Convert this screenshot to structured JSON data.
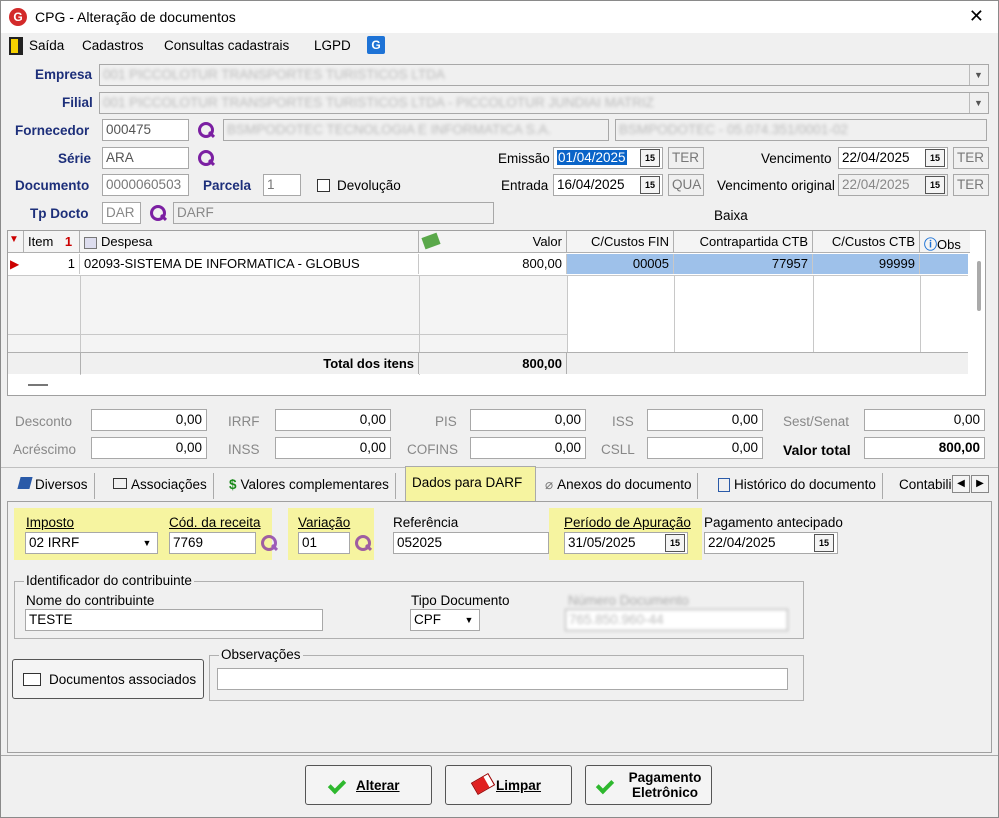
{
  "window": {
    "title": "CPG - Alteração de documentos",
    "close": "✕"
  },
  "menu": {
    "items": [
      "Saída",
      "Cadastros",
      "Consultas cadastrais",
      "LGPD"
    ]
  },
  "header": {
    "empresa_label": "Empresa",
    "empresa_value": "001 PICCOLOTUR TRANSPORTES TURISTICOS LTDA",
    "filial_label": "Filial",
    "filial_value": "001 PICCOLOTUR TRANSPORTES TURISTICOS LTDA - PICCOLOTUR JUNDIAI MATRIZ",
    "fornecedor_label": "Fornecedor",
    "fornecedor_code": "000475",
    "fornecedor_name": "BSMPODOTEC TECNOLOGIA E INFORMATICA S.A.",
    "fornecedor_extra": "BSMPODOTEC - 05.074.351/0001-02",
    "serie_label": "Série",
    "serie_value": "ARA",
    "documento_label": "Documento",
    "documento_value": "0000060503",
    "parcela_label": "Parcela",
    "parcela_value": "1",
    "devolucao_label": "Devolução",
    "tpdocto_label": "Tp Docto",
    "tpdocto_code": "DAR",
    "tpdocto_name": "DARF",
    "emissao_label": "Emissão",
    "emissao_value": "01/04/2025",
    "emissao_day": "TER",
    "entrada_label": "Entrada",
    "entrada_value": "16/04/2025",
    "entrada_day": "QUA",
    "vencimento_label": "Vencimento",
    "vencimento_value": "22/04/2025",
    "vencimento_day": "TER",
    "venc_original_label": "Vencimento original",
    "venc_original_value": "22/04/2025",
    "venc_original_day": "TER",
    "baixa_label": "Baixa",
    "cal_icon_text": "15"
  },
  "grid": {
    "columns": [
      "Item",
      "Despesa",
      "Valor",
      "C/Custos FIN",
      "Contrapartida CTB",
      "C/Custos CTB",
      "Obs"
    ],
    "rows": [
      {
        "item": "1",
        "despesa": "02093-SISTEMA DE INFORMATICA - GLOBUS",
        "valor": "800,00",
        "cc_fin": "00005",
        "contrapartida": "77957",
        "cc_ctb": "99999"
      }
    ],
    "total_label": "Total dos itens",
    "total_value": "800,00",
    "sort_indicator": "1"
  },
  "totals": {
    "desconto_label": "Desconto",
    "desconto": "0,00",
    "irrf_label": "IRRF",
    "irrf": "0,00",
    "pis_label": "PIS",
    "pis": "0,00",
    "iss_label": "ISS",
    "iss": "0,00",
    "sest_label": "Sest/Senat",
    "sest": "0,00",
    "acrescimo_label": "Acréscimo",
    "acrescimo": "0,00",
    "inss_label": "INSS",
    "inss": "0,00",
    "cofins_label": "COFINS",
    "cofins": "0,00",
    "csll_label": "CSLL",
    "csll": "0,00",
    "valor_total_label": "Valor total",
    "valor_total": "800,00"
  },
  "tabs": [
    "Diversos",
    "Associações",
    "Valores complementares",
    "Dados para DARF",
    "Anexos do documento",
    "Histórico do documento",
    "Contabili"
  ],
  "darf": {
    "imposto_label": "Imposto",
    "imposto_value": "02 IRRF",
    "receita_label": "Cód. da receita",
    "receita_value": "7769",
    "variacao_label": "Variação",
    "variacao_value": "01",
    "referencia_label": "Referência",
    "referencia_value": "052025",
    "periodo_label": "Período de Apuração",
    "periodo_value": "31/05/2025",
    "pagamento_label": "Pagamento antecipado",
    "pagamento_value": "22/04/2025",
    "contribuinte_group": "Identificador do contribuinte",
    "nome_label": "Nome do contribuinte",
    "nome_value": "TESTE",
    "tipo_label": "Tipo Documento",
    "tipo_value": "CPF",
    "numero_label": "Número Documento",
    "numero_value": "765.850.960-44",
    "docs_button": "Documentos associados",
    "obs_label": "Observações",
    "obs_value": ""
  },
  "footer": {
    "alterar": "Alterar",
    "limpar": "Limpar",
    "pagamento_line1": "Pagamento",
    "pagamento_line2": "Eletrônico"
  }
}
